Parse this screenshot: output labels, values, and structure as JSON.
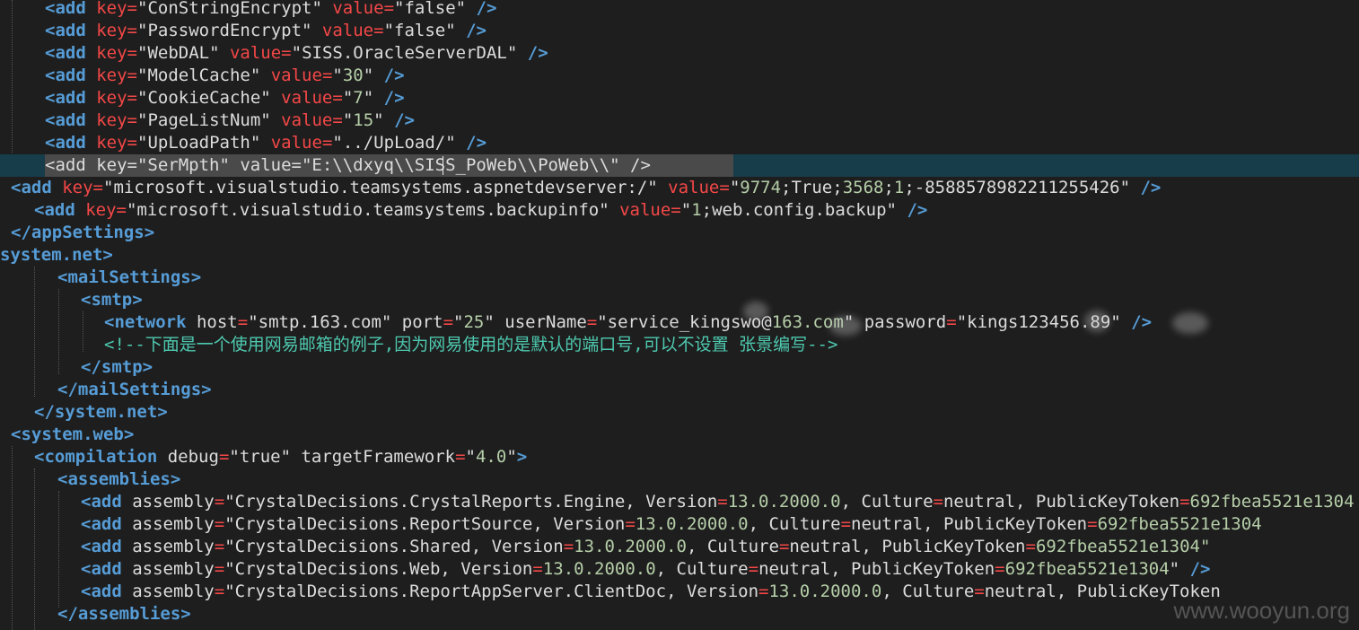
{
  "colors": {
    "background": "#1e1e1e",
    "tag": "#569cd6",
    "attr": "#f44747",
    "attr_plain": "#dcdcdc",
    "string": "#dcdcdc",
    "number": "#b5cea8",
    "comment": "#4ec9b0",
    "highlight_band": "#173c4a",
    "selection": "#4a4a4a"
  },
  "code_lines": [
    {
      "tokens": [
        {
          "t": "<add",
          "c": "tag"
        },
        {
          "t": " "
        },
        {
          "t": "key",
          "c": "attr"
        },
        {
          "t": "=",
          "c": "attr"
        },
        {
          "t": "\"ConStringEncrypt\"",
          "c": "str"
        },
        {
          "t": " "
        },
        {
          "t": "value",
          "c": "attr"
        },
        {
          "t": "=",
          "c": "attr"
        },
        {
          "t": "\"false\"",
          "c": "str"
        },
        {
          "t": " "
        },
        {
          "t": "/>",
          "c": "tag"
        }
      ]
    },
    {
      "tokens": [
        {
          "t": "<add",
          "c": "tag"
        },
        {
          "t": " "
        },
        {
          "t": "key",
          "c": "attr"
        },
        {
          "t": "=",
          "c": "attr"
        },
        {
          "t": "\"PasswordEncrypt\"",
          "c": "str"
        },
        {
          "t": " "
        },
        {
          "t": "value",
          "c": "attr"
        },
        {
          "t": "=",
          "c": "attr"
        },
        {
          "t": "\"false\"",
          "c": "str"
        },
        {
          "t": " "
        },
        {
          "t": "/>",
          "c": "tag"
        }
      ]
    },
    {
      "tokens": [
        {
          "t": "<add",
          "c": "tag"
        },
        {
          "t": " "
        },
        {
          "t": "key",
          "c": "attr"
        },
        {
          "t": "=",
          "c": "attr"
        },
        {
          "t": "\"WebDAL\"",
          "c": "str"
        },
        {
          "t": " "
        },
        {
          "t": "value",
          "c": "attr"
        },
        {
          "t": "=",
          "c": "attr"
        },
        {
          "t": "\"SISS.OracleServerDAL\"",
          "c": "str"
        },
        {
          "t": " "
        },
        {
          "t": "/>",
          "c": "tag"
        }
      ]
    },
    {
      "tokens": [
        {
          "t": "<add",
          "c": "tag"
        },
        {
          "t": " "
        },
        {
          "t": "key",
          "c": "attr"
        },
        {
          "t": "=",
          "c": "attr"
        },
        {
          "t": "\"ModelCache\"",
          "c": "str"
        },
        {
          "t": " "
        },
        {
          "t": "value",
          "c": "attr"
        },
        {
          "t": "=",
          "c": "attr"
        },
        {
          "t": "\"",
          "c": "str"
        },
        {
          "t": "30",
          "c": "num"
        },
        {
          "t": "\"",
          "c": "str"
        },
        {
          "t": " "
        },
        {
          "t": "/>",
          "c": "tag"
        }
      ]
    },
    {
      "tokens": [
        {
          "t": "<add",
          "c": "tag"
        },
        {
          "t": " "
        },
        {
          "t": "key",
          "c": "attr"
        },
        {
          "t": "=",
          "c": "attr"
        },
        {
          "t": "\"CookieCache\"",
          "c": "str"
        },
        {
          "t": " "
        },
        {
          "t": "value",
          "c": "attr"
        },
        {
          "t": "=",
          "c": "attr"
        },
        {
          "t": "\"",
          "c": "str"
        },
        {
          "t": "7",
          "c": "num"
        },
        {
          "t": "\"",
          "c": "str"
        },
        {
          "t": " "
        },
        {
          "t": "/>",
          "c": "tag"
        }
      ]
    },
    {
      "tokens": [
        {
          "t": "<add",
          "c": "tag"
        },
        {
          "t": " "
        },
        {
          "t": "key",
          "c": "attr"
        },
        {
          "t": "=",
          "c": "attr"
        },
        {
          "t": "\"PageListNum\"",
          "c": "str"
        },
        {
          "t": " "
        },
        {
          "t": "value",
          "c": "attr"
        },
        {
          "t": "=",
          "c": "attr"
        },
        {
          "t": "\"",
          "c": "str"
        },
        {
          "t": "15",
          "c": "num"
        },
        {
          "t": "\"",
          "c": "str"
        },
        {
          "t": " "
        },
        {
          "t": "/>",
          "c": "tag"
        }
      ]
    },
    {
      "tokens": [
        {
          "t": "<add",
          "c": "tag"
        },
        {
          "t": " "
        },
        {
          "t": "key",
          "c": "attr"
        },
        {
          "t": "=",
          "c": "attr"
        },
        {
          "t": "\"UpLoadPath\"",
          "c": "str"
        },
        {
          "t": " "
        },
        {
          "t": "value",
          "c": "attr"
        },
        {
          "t": "=",
          "c": "attr"
        },
        {
          "t": "\"../UpLoad/\"",
          "c": "str"
        },
        {
          "t": " "
        },
        {
          "t": "/>",
          "c": "tag"
        }
      ]
    },
    {
      "tokens": [
        {
          "t": "<add key=\"SerMpth\" value=\"E:\\\\dxyq\\\\SISS_PoWeb\\\\PoWeb\\\\\" />",
          "c": "plain"
        }
      ]
    },
    {
      "tokens": [
        {
          "t": "<add",
          "c": "tag"
        },
        {
          "t": " "
        },
        {
          "t": "key",
          "c": "attr"
        },
        {
          "t": "=",
          "c": "attr"
        },
        {
          "t": "\"microsoft.visualstudio.teamsystems.aspnetdevserver:/\"",
          "c": "str"
        },
        {
          "t": " "
        },
        {
          "t": "value",
          "c": "attr"
        },
        {
          "t": "=",
          "c": "attr"
        },
        {
          "t": "\"",
          "c": "str"
        },
        {
          "t": "9774",
          "c": "num"
        },
        {
          "t": ";True;",
          "c": "str"
        },
        {
          "t": "3568",
          "c": "num"
        },
        {
          "t": ";",
          "c": "str"
        },
        {
          "t": "1",
          "c": "num"
        },
        {
          "t": ";-8588578982211255426\"",
          "c": "str"
        },
        {
          "t": " "
        },
        {
          "t": "/>",
          "c": "tag"
        }
      ]
    },
    {
      "tokens": [
        {
          "t": "<add",
          "c": "tag"
        },
        {
          "t": " "
        },
        {
          "t": "key",
          "c": "attr"
        },
        {
          "t": "=",
          "c": "attr"
        },
        {
          "t": "\"microsoft.visualstudio.teamsystems.backupinfo\"",
          "c": "str"
        },
        {
          "t": " "
        },
        {
          "t": "value",
          "c": "attr"
        },
        {
          "t": "=",
          "c": "attr"
        },
        {
          "t": "\"",
          "c": "str"
        },
        {
          "t": "1",
          "c": "num"
        },
        {
          "t": ";web.config.backup\"",
          "c": "str"
        },
        {
          "t": " "
        },
        {
          "t": "/>",
          "c": "tag"
        }
      ]
    },
    {
      "tokens": [
        {
          "t": "</appSettings>",
          "c": "tag"
        }
      ]
    },
    {
      "tokens": [
        {
          "t": "system.net>",
          "c": "tag"
        }
      ]
    },
    {
      "tokens": [
        {
          "t": "<mailSettings>",
          "c": "tag"
        }
      ]
    },
    {
      "tokens": [
        {
          "t": "<smtp>",
          "c": "tag"
        }
      ]
    },
    {
      "tokens": [
        {
          "t": "<network",
          "c": "tag"
        },
        {
          "t": " "
        },
        {
          "t": "host",
          "c": "plainattr"
        },
        {
          "t": "=",
          "c": "attr"
        },
        {
          "t": "\"smtp.163.com\"",
          "c": "str"
        },
        {
          "t": " "
        },
        {
          "t": "port",
          "c": "plainattr"
        },
        {
          "t": "=",
          "c": "attr"
        },
        {
          "t": "\"",
          "c": "str"
        },
        {
          "t": "25",
          "c": "num"
        },
        {
          "t": "\"",
          "c": "str"
        },
        {
          "t": " "
        },
        {
          "t": "userName",
          "c": "plainattr"
        },
        {
          "t": "=",
          "c": "attr"
        },
        {
          "t": "\"service_kingsw",
          "c": "str"
        },
        {
          "t": "o",
          "c": "str"
        },
        {
          "t": "@",
          "c": "str"
        },
        {
          "t": "163.com",
          "c": "num"
        },
        {
          "t": "\"",
          "c": "str"
        },
        {
          "t": " "
        },
        {
          "t": "password",
          "c": "plainattr"
        },
        {
          "t": "=",
          "c": "attr"
        },
        {
          "t": "\"kings123456.89\"",
          "c": "str"
        },
        {
          "t": " "
        },
        {
          "t": "/>",
          "c": "tag"
        }
      ]
    },
    {
      "tokens": [
        {
          "t": "<!--下面是一个使用网易邮箱的例子,因为网易使用的是默认的端口号,可以不设置 张景编写-->",
          "c": "comment"
        }
      ]
    },
    {
      "tokens": [
        {
          "t": "</smtp>",
          "c": "tag"
        }
      ]
    },
    {
      "tokens": [
        {
          "t": "</mailSettings>",
          "c": "tag"
        }
      ]
    },
    {
      "tokens": [
        {
          "t": "</system.net>",
          "c": "tag"
        }
      ]
    },
    {
      "tokens": [
        {
          "t": "<system.web>",
          "c": "tag"
        }
      ]
    },
    {
      "tokens": [
        {
          "t": "<compilation",
          "c": "tag"
        },
        {
          "t": " "
        },
        {
          "t": "debug",
          "c": "plainattr"
        },
        {
          "t": "=",
          "c": "attr"
        },
        {
          "t": "\"true\"",
          "c": "str"
        },
        {
          "t": " "
        },
        {
          "t": "targetFramework",
          "c": "plainattr"
        },
        {
          "t": "=",
          "c": "attr"
        },
        {
          "t": "\"",
          "c": "str"
        },
        {
          "t": "4.0",
          "c": "num"
        },
        {
          "t": "\"",
          "c": "str"
        },
        {
          "t": ">",
          "c": "tag"
        }
      ]
    },
    {
      "tokens": [
        {
          "t": "<assemblies>",
          "c": "tag"
        }
      ]
    },
    {
      "tokens": [
        {
          "t": "<add",
          "c": "tag"
        },
        {
          "t": " "
        },
        {
          "t": "assembly",
          "c": "plainattr"
        },
        {
          "t": "=",
          "c": "attr"
        },
        {
          "t": "\"CrystalDecisions.CrystalReports.Engine, Version",
          "c": "str"
        },
        {
          "t": "=",
          "c": "attr"
        },
        {
          "t": "13.0.2000.0",
          "c": "num"
        },
        {
          "t": ", Culture",
          "c": "str"
        },
        {
          "t": "=",
          "c": "attr"
        },
        {
          "t": "neutral, PublicKeyToken",
          "c": "str"
        },
        {
          "t": "=",
          "c": "attr"
        },
        {
          "t": "692fbea5521e1304",
          "c": "num"
        }
      ]
    },
    {
      "tokens": [
        {
          "t": "<add",
          "c": "tag"
        },
        {
          "t": " "
        },
        {
          "t": "assembly",
          "c": "plainattr"
        },
        {
          "t": "=",
          "c": "attr"
        },
        {
          "t": "\"CrystalDecisions.ReportSource, Version",
          "c": "str"
        },
        {
          "t": "=",
          "c": "attr"
        },
        {
          "t": "13.0.2000.0",
          "c": "num"
        },
        {
          "t": ", Culture",
          "c": "str"
        },
        {
          "t": "=",
          "c": "attr"
        },
        {
          "t": "neutral, PublicKeyToken",
          "c": "str"
        },
        {
          "t": "=",
          "c": "attr"
        },
        {
          "t": "692fbea5521e1304",
          "c": "num"
        }
      ]
    },
    {
      "tokens": [
        {
          "t": "<add",
          "c": "tag"
        },
        {
          "t": " "
        },
        {
          "t": "assembly",
          "c": "plainattr"
        },
        {
          "t": "=",
          "c": "attr"
        },
        {
          "t": "\"CrystalDecisions.Shared, Version",
          "c": "str"
        },
        {
          "t": "=",
          "c": "attr"
        },
        {
          "t": "13.0.2000.0",
          "c": "num"
        },
        {
          "t": ", Culture",
          "c": "str"
        },
        {
          "t": "=",
          "c": "attr"
        },
        {
          "t": "neutral, PublicKeyToken",
          "c": "str"
        },
        {
          "t": "=",
          "c": "attr"
        },
        {
          "t": "692fbea5521e1304\"",
          "c": "num"
        }
      ]
    },
    {
      "tokens": [
        {
          "t": "<add",
          "c": "tag"
        },
        {
          "t": " "
        },
        {
          "t": "assembly",
          "c": "plainattr"
        },
        {
          "t": "=",
          "c": "attr"
        },
        {
          "t": "\"CrystalDecisions.Web, Version",
          "c": "str"
        },
        {
          "t": "=",
          "c": "attr"
        },
        {
          "t": "13.0.2000.0",
          "c": "num"
        },
        {
          "t": ", Culture",
          "c": "str"
        },
        {
          "t": "=",
          "c": "attr"
        },
        {
          "t": "neutral, PublicKeyToken",
          "c": "str"
        },
        {
          "t": "=",
          "c": "attr"
        },
        {
          "t": "692fbea5521e1304",
          "c": "num"
        },
        {
          "t": "\"",
          "c": "str"
        },
        {
          "t": " "
        },
        {
          "t": "/>",
          "c": "tag"
        }
      ]
    },
    {
      "tokens": [
        {
          "t": "<add",
          "c": "tag"
        },
        {
          "t": " "
        },
        {
          "t": "assembly",
          "c": "plainattr"
        },
        {
          "t": "=",
          "c": "attr"
        },
        {
          "t": "\"CrystalDecisions.ReportAppServer.ClientDoc, Version",
          "c": "str"
        },
        {
          "t": "=",
          "c": "attr"
        },
        {
          "t": "13.0.2000.0",
          "c": "num"
        },
        {
          "t": ", Culture",
          "c": "str"
        },
        {
          "t": "=",
          "c": "attr"
        },
        {
          "t": "neutral, PublicKeyToken",
          "c": "str"
        }
      ]
    },
    {
      "tokens": [
        {
          "t": "</assemblies>",
          "c": "tag"
        }
      ]
    }
  ],
  "watermark": "www.wooyun.org"
}
